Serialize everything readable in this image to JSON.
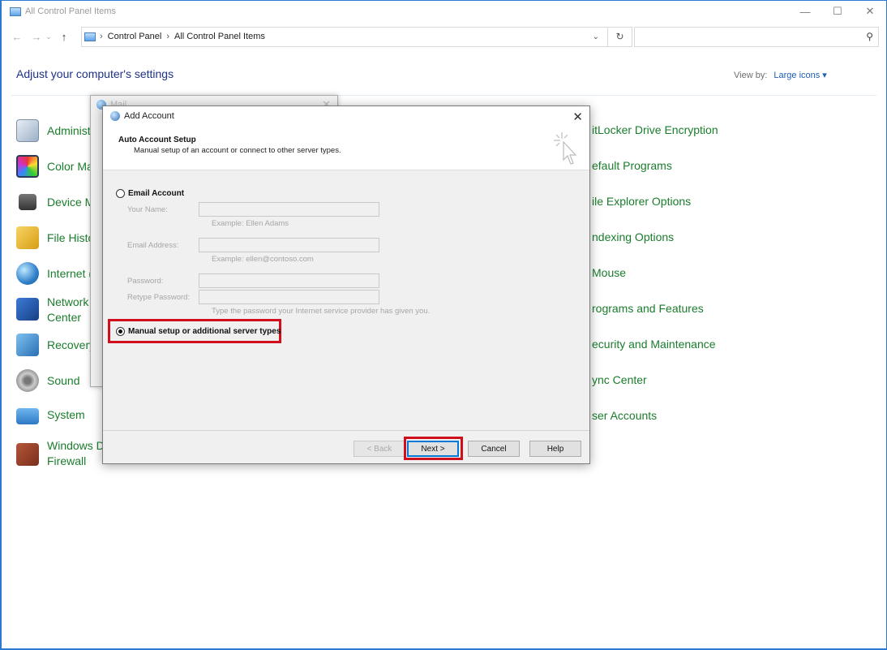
{
  "window": {
    "title": "All Control Panel Items",
    "controls": {
      "minimize": "—",
      "maximize": "☐",
      "close": "✕"
    }
  },
  "nav": {
    "back": "←",
    "forward": "→",
    "dropdown": "⌄",
    "up": "↑",
    "breadcrumb": [
      "Control Panel",
      "All Control Panel Items"
    ],
    "separator": "›",
    "refresh": "↻",
    "chevron": "⌄",
    "search_placeholder": "",
    "search_glyph": "⚲"
  },
  "page": {
    "heading": "Adjust your computer's settings",
    "view_by_label": "View by:",
    "view_by_value": "Large icons ▾"
  },
  "left_items": [
    {
      "label": "Administ",
      "icon": "administrative-tools-icon"
    },
    {
      "label": "Color Ma",
      "icon": "color-management-icon"
    },
    {
      "label": "Device M",
      "icon": "device-manager-icon"
    },
    {
      "label": "File Histo",
      "icon": "file-history-icon"
    },
    {
      "label": "Internet (",
      "icon": "internet-options-icon"
    },
    {
      "label": "Network\nCenter",
      "icon": "network-center-icon"
    },
    {
      "label": "Recovery",
      "icon": "recovery-icon"
    },
    {
      "label": "Sound",
      "icon": "sound-icon"
    },
    {
      "label": "System",
      "icon": "system-icon"
    },
    {
      "label": "Windows D\nFirewall",
      "icon": "windows-firewall-icon"
    }
  ],
  "right_items": [
    "itLocker Drive Encryption",
    "efault Programs",
    "ile Explorer Options",
    "ndexing Options",
    "Mouse",
    "rograms and Features",
    "ecurity and Maintenance",
    "ync Center",
    "ser Accounts"
  ],
  "mail_dialog": {
    "title": "Mail",
    "close": "✕"
  },
  "dialog": {
    "title": "Add Account",
    "close": "✕",
    "header_title": "Auto Account Setup",
    "header_subtitle": "Manual setup of an account or connect to other server types.",
    "email_account_label": "Email Account",
    "fields": {
      "name_label": "Your Name:",
      "name_hint": "Example: Ellen Adams",
      "email_label": "Email Address:",
      "email_hint": "Example: ellen@contoso.com",
      "password_label": "Password:",
      "retype_label": "Retype Password:",
      "password_hint": "Type the password your Internet service provider has given you."
    },
    "manual_label": "Manual setup or additional server types",
    "buttons": {
      "back": "< Back",
      "next": "Next >",
      "cancel": "Cancel",
      "help": "Help"
    }
  },
  "colors": {
    "link_green": "#1a7d2c",
    "heading_blue": "#1e3287",
    "highlight_red": "#d00f1d"
  }
}
